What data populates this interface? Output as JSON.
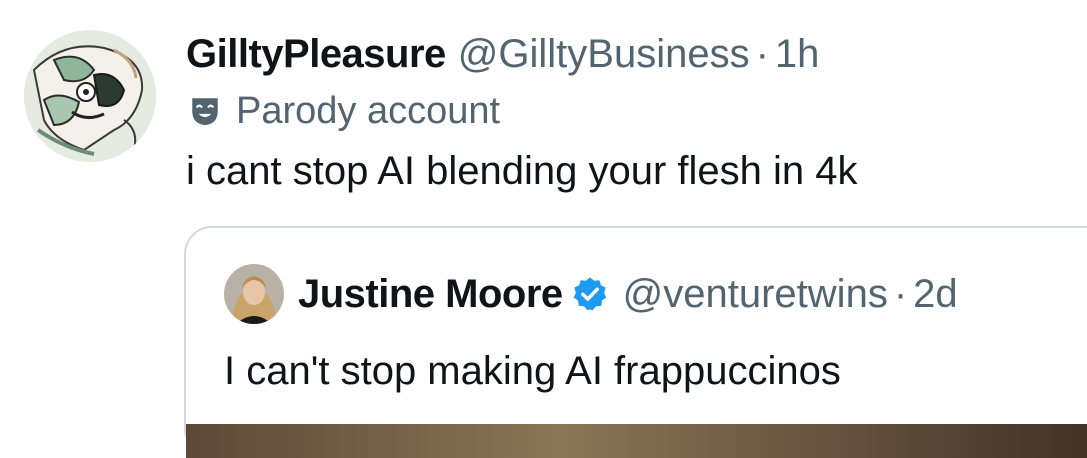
{
  "tweet": {
    "display_name": "GilltyPleasure",
    "handle": "@GilltyBusiness",
    "separator": "·",
    "time": "1h",
    "parody_label": "Parody account",
    "text": "i cant stop AI blending your flesh in 4k",
    "avatar_icon": "comic-illustration-avatar",
    "parody_icon": "theater-mask-icon"
  },
  "quote": {
    "display_name": "Justine Moore",
    "handle": "@venturetwins",
    "separator": "·",
    "time": "2d",
    "text": "I can't stop making AI frappuccinos",
    "verified_icon": "verified-badge-icon",
    "verified_color": "#1d9bf0"
  },
  "colors": {
    "text_primary": "#0f1419",
    "text_secondary": "#536471",
    "border": "#cfd9de"
  }
}
